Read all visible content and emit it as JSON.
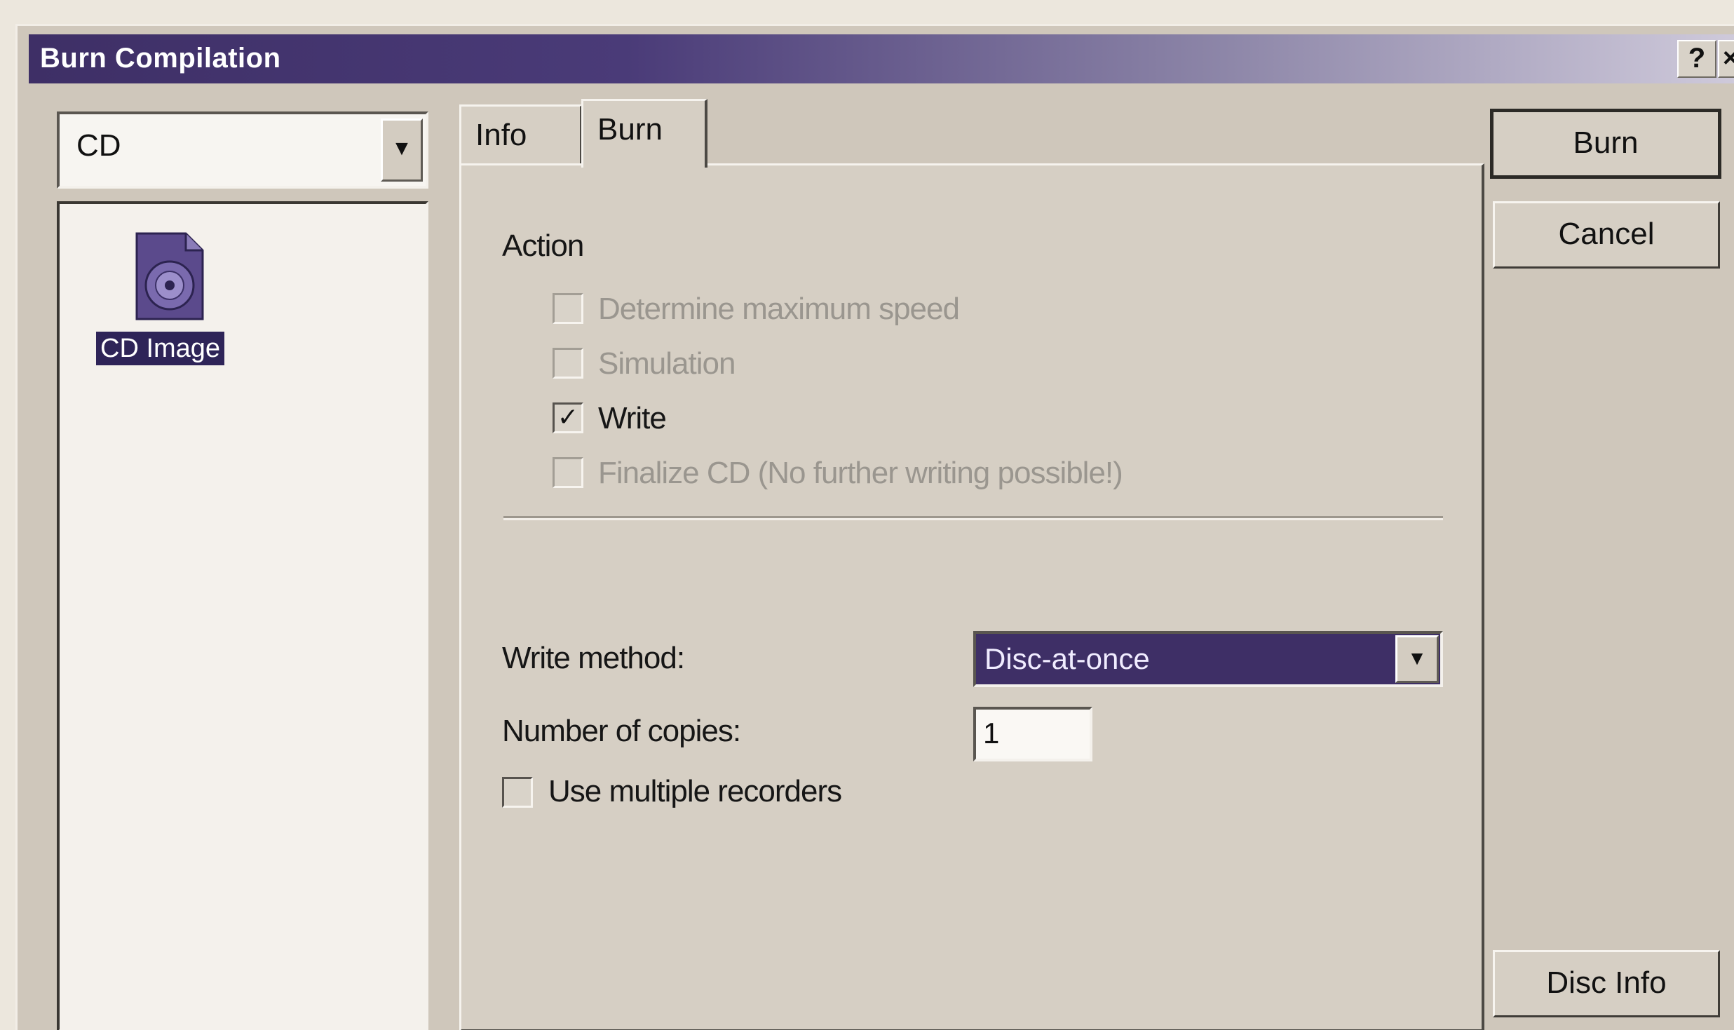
{
  "window": {
    "title": "Burn Compilation",
    "help_glyph": "?",
    "close_glyph": "×"
  },
  "left_panel": {
    "media_type": "CD",
    "items": [
      {
        "label": "CD Image",
        "icon": "cd-image-icon"
      }
    ]
  },
  "tabs": [
    {
      "label": "Info",
      "active": false
    },
    {
      "label": "Burn",
      "active": true
    }
  ],
  "burn_tab": {
    "action_heading": "Action",
    "options": [
      {
        "label": "Determine maximum speed",
        "checked": false,
        "enabled": false
      },
      {
        "label": "Simulation",
        "checked": false,
        "enabled": false
      },
      {
        "label": "Write",
        "checked": true,
        "enabled": true
      },
      {
        "label": "Finalize CD (No further writing possible!)",
        "checked": false,
        "enabled": false
      }
    ],
    "write_method_label": "Write method:",
    "write_method_value": "Disc-at-once",
    "copies_label": "Number of copies:",
    "copies_value": "1",
    "multiple_recorders_label": "Use multiple recorders",
    "multiple_recorders_checked": false
  },
  "buttons": {
    "burn": "Burn",
    "cancel": "Cancel",
    "disc_info": "Disc Info"
  },
  "colors": {
    "titlebar": "#3e2f66",
    "selection": "#2e2458",
    "dialog_face": "#d6cfc4"
  }
}
